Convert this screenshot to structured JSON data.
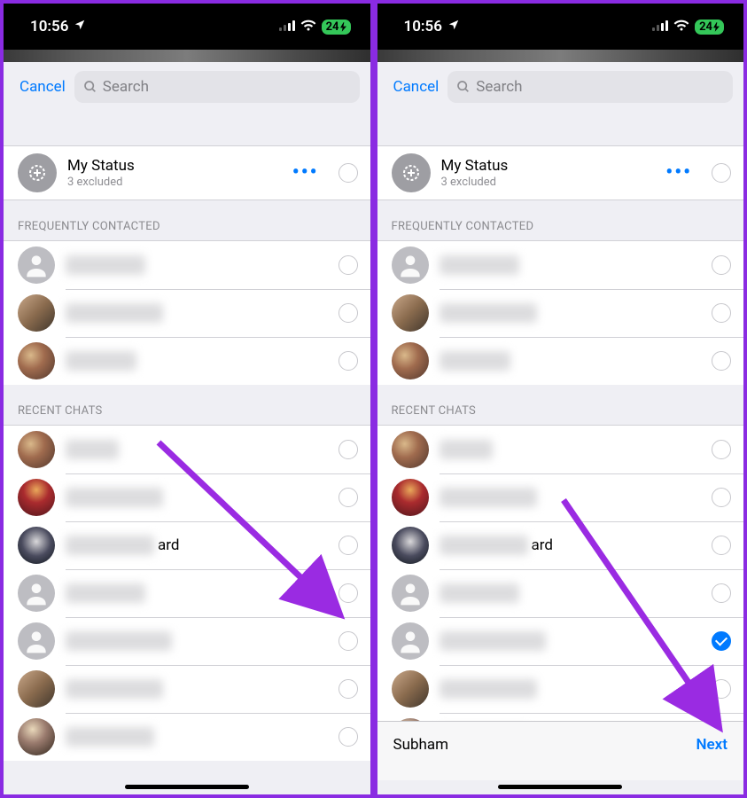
{
  "status": {
    "time": "10:56",
    "battery": "24"
  },
  "header": {
    "cancel": "Cancel",
    "search_placeholder": "Search"
  },
  "my_status": {
    "title": "My Status",
    "subtitle": "3 excluded"
  },
  "sections": {
    "frequent_header": "FREQUENTLY CONTACTED",
    "recent_header": "RECENT CHATS"
  },
  "frequent": [
    {
      "blur_w": 90,
      "avatar": "gray"
    },
    {
      "blur_w": 110,
      "avatar": "photo"
    },
    {
      "blur_w": 80,
      "avatar": "photo2"
    }
  ],
  "left": {
    "recent": [
      {
        "blur_w": 60,
        "avatar": "photo2",
        "suffix": ""
      },
      {
        "blur_w": 110,
        "avatar": "photo3",
        "suffix": ""
      },
      {
        "blur_w": 100,
        "avatar": "photo5",
        "suffix": "ard"
      },
      {
        "blur_w": 90,
        "avatar": "gray",
        "suffix": ""
      },
      {
        "blur_w": 120,
        "avatar": "gray",
        "suffix": ""
      },
      {
        "blur_w": 110,
        "avatar": "photo",
        "suffix": ""
      },
      {
        "blur_w": 100,
        "avatar": "photo4",
        "suffix": ""
      }
    ]
  },
  "right": {
    "recent": [
      {
        "blur_w": 60,
        "avatar": "photo2",
        "suffix": "",
        "checked": false
      },
      {
        "blur_w": 110,
        "avatar": "photo3",
        "suffix": "",
        "checked": false
      },
      {
        "blur_w": 100,
        "avatar": "photo5",
        "suffix": "ard",
        "checked": false
      },
      {
        "blur_w": 90,
        "avatar": "gray",
        "suffix": "",
        "checked": false
      },
      {
        "blur_w": 120,
        "avatar": "gray",
        "suffix": "",
        "checked": true
      },
      {
        "blur_w": 110,
        "avatar": "photo",
        "suffix": "",
        "checked": false
      },
      {
        "blur_w": 100,
        "avatar": "photo4",
        "suffix": "",
        "checked": false
      }
    ],
    "footer": {
      "name": "Subham",
      "next": "Next"
    }
  }
}
